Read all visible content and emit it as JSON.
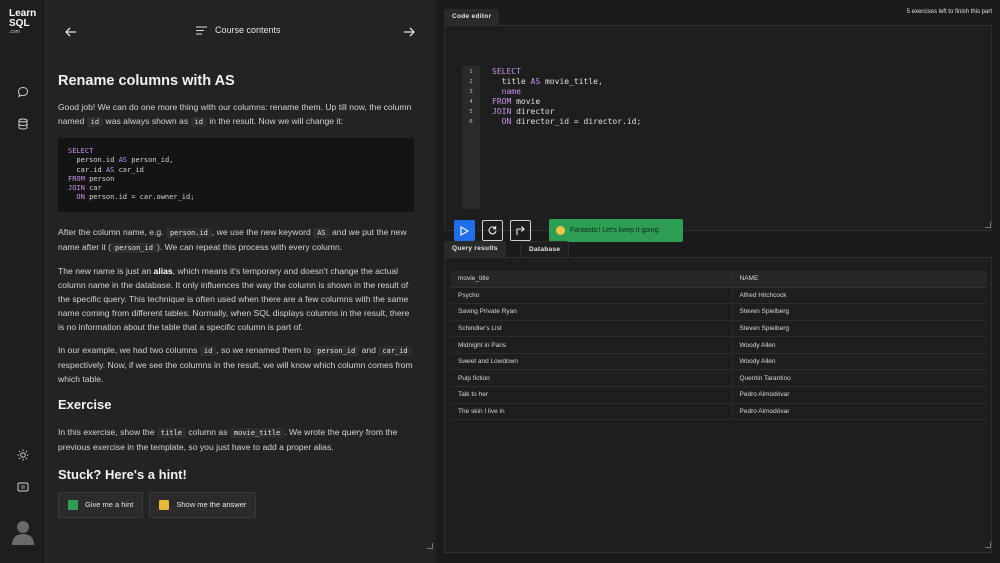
{
  "logo": {
    "line1": "Learn",
    "line2": "SQL",
    "line3": ".com"
  },
  "rail": {
    "icons": [
      "chat-icon",
      "database-icon",
      "sun-icon",
      "keyboard-icon",
      "avatar-icon"
    ]
  },
  "header": {
    "course_contents": "Course contents"
  },
  "lesson": {
    "title": "Rename columns with AS",
    "intro_p1": "Good job! We can do one more thing with our columns: rename them. Up till now, the column named ",
    "intro_code1": "id",
    "intro_p2": " was always shown as ",
    "intro_code2": "id",
    "intro_p3": " in the result. Now we will change it:",
    "example_code": [
      {
        "kw": "SELECT",
        "rest": ""
      },
      {
        "kw": "",
        "rest": "  person.id ",
        "kw2": "AS",
        "rest2": " person_id,"
      },
      {
        "kw": "",
        "rest": "  car.id ",
        "kw2": "AS",
        "rest2": " car_id"
      },
      {
        "kw": "FROM",
        "rest": " person"
      },
      {
        "kw": "JOIN",
        "rest": " car"
      },
      {
        "kw": "  ON",
        "rest": " person.id = car.owner_id;"
      }
    ],
    "after_p1": "After the column name, e.g. ",
    "after_code1": "person.id",
    "after_p2": ", we use the new keyword ",
    "after_code2": "AS",
    "after_p3": " and we put the new name after it (",
    "after_code3": "person_id",
    "after_p4": "). We can repeat this process with every column.",
    "alias_p1": "The new name is just an ",
    "alias_bold": "alias",
    "alias_p2": ", which means it's temporary and doesn't change the actual column name in the database. It only influences the way the column is shown in the result of the specific query. This technique is often used when there are a few columns with the same name coming from different tables. Normally, when SQL displays columns in the result, there is no information about the table that a specific column is part of.",
    "example_p1": "In our example, we had two columns ",
    "example_code1": "id",
    "example_p2": ", so we renamed them to ",
    "example_code2": "person_id",
    "example_p3": " and ",
    "example_code3": "car_id",
    "example_p4": " respectively. Now, if we see the columns in the result, we will know which column comes from which table.",
    "exercise_title": "Exercise",
    "exercise_p1": "In this exercise, show the ",
    "exercise_code1": "title",
    "exercise_p2": " column as ",
    "exercise_code2": "movie_title",
    "exercise_p3": ". We wrote the query from the previous exercise in the template, so you just have to add a proper alias.",
    "hint_title": "Stuck? Here's a hint!",
    "hint_button": "Give me a hint",
    "answer_button": "Show me the answer"
  },
  "editor": {
    "tab": "Code editor",
    "remaining": "5 exercises left to finish this part",
    "line_numbers": [
      "1",
      "2",
      "3",
      "4",
      "5",
      "6"
    ],
    "code_lines": [
      [
        {
          "t": "SELECT",
          "c": "kw"
        }
      ],
      [
        {
          "t": "  title ",
          "c": ""
        },
        {
          "t": "AS",
          "c": "kw"
        },
        {
          "t": " movie_title,",
          "c": ""
        }
      ],
      [
        {
          "t": "  name",
          "c": "kw"
        }
      ],
      [
        {
          "t": "FROM",
          "c": "kw"
        },
        {
          "t": " movie",
          "c": ""
        }
      ],
      [
        {
          "t": "JOIN",
          "c": "kw"
        },
        {
          "t": " director",
          "c": ""
        }
      ],
      [
        {
          "t": "  ON",
          "c": "kw"
        },
        {
          "t": " director_id = director.id;",
          "c": ""
        }
      ]
    ],
    "toast": "Fantastic! Let's keep it going."
  },
  "results": {
    "tabs": [
      "Query results",
      "Database"
    ],
    "columns": [
      "movie_title",
      "NAME"
    ],
    "rows": [
      [
        "Psycho",
        "Alfred Hitchcock"
      ],
      [
        "Saving Private Ryan",
        "Steven Spielberg"
      ],
      [
        "Schindler's List",
        "Steven Spielberg"
      ],
      [
        "Midnight in Paris",
        "Woody Allen"
      ],
      [
        "Sweet and Lowdown",
        "Woody Allen"
      ],
      [
        "Pulp fiction",
        "Quentin Tarantino"
      ],
      [
        "Talk to her",
        "Pedro Almodóvar"
      ],
      [
        "The skin I live in",
        "Pedro Almodóvar"
      ]
    ]
  },
  "colors": {
    "accent": "#1f6feb",
    "success": "#2f9e55",
    "tab_active": "#2a2a2a"
  }
}
